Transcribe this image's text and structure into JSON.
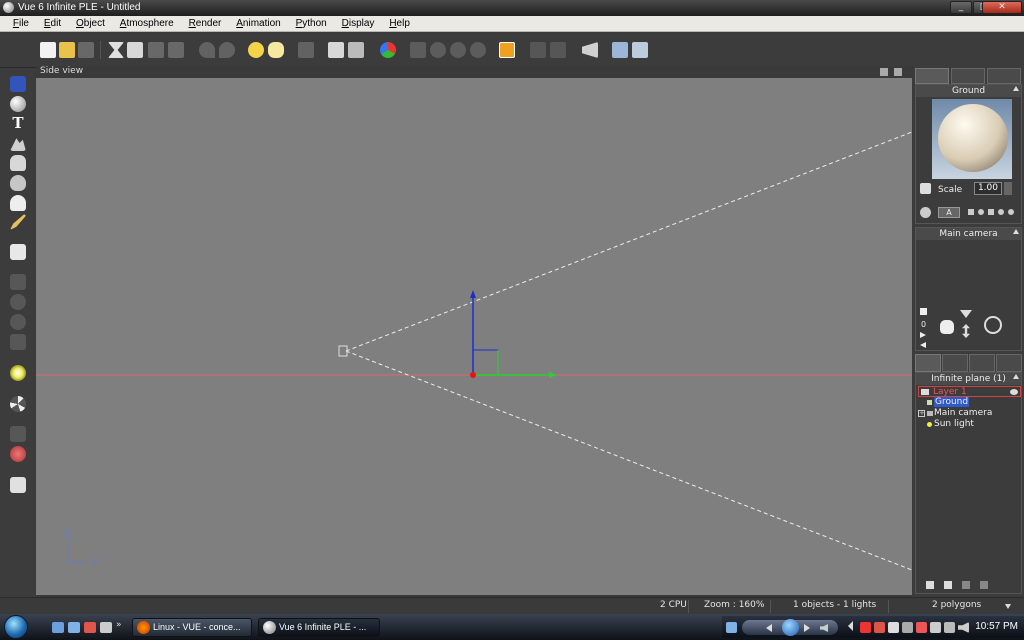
{
  "window": {
    "title": "Vue 6 Infinite PLE - Untitled",
    "minimize": "_",
    "maximize": "□",
    "close": "✕"
  },
  "menu": [
    "File",
    "Edit",
    "Object",
    "Atmosphere",
    "Render",
    "Animation",
    "Python",
    "Display",
    "Help"
  ],
  "viewport": {
    "label": "Side view",
    "axis_z": "Z",
    "axis_y": "Y"
  },
  "material_panel": {
    "name": "Ground",
    "scale_label": "Scale",
    "scale_value": "1.00",
    "button_a": "A"
  },
  "camera_panel": {
    "name": "Main camera",
    "frame": "0"
  },
  "world_browser": {
    "header": "Infinite plane (1)",
    "items": [
      {
        "label": "Layer 1"
      },
      {
        "label": "Ground"
      },
      {
        "label": "Main camera"
      },
      {
        "label": "Sun light"
      }
    ]
  },
  "status": {
    "cpu": "2 CPU",
    "zoom": "Zoom : 160%",
    "objects": "1 objects - 1 lights",
    "polygons": "2 polygons"
  },
  "taskbar": {
    "tasks": [
      {
        "label": "Linux - VUE - conce..."
      },
      {
        "label": "Vue 6 Infinite PLE - ..."
      }
    ],
    "clock": "10:57 PM"
  },
  "colors": {
    "viewport_bg": "#7f7f7f",
    "axis_x": "#2bd12b",
    "axis_z": "#1b2fd0",
    "ground_line": "#d96a6a",
    "selection": "#2f5ac9"
  }
}
